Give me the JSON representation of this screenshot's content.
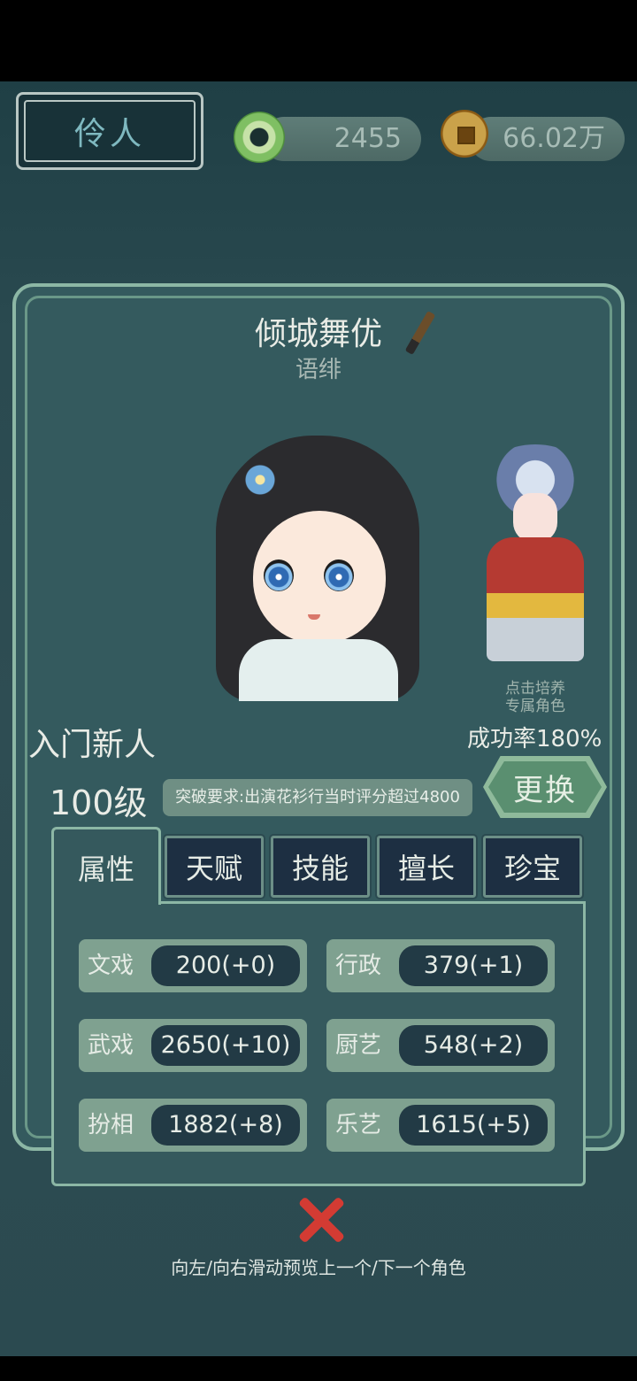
{
  "header": {
    "title": "伶人",
    "jade_amount": "2455",
    "coin_amount": "66.02万"
  },
  "character": {
    "name": "倾城舞优",
    "subtitle": "语绯",
    "rank": "入门新人",
    "level": "100级"
  },
  "special_role": {
    "caption_line1": "点击培养",
    "caption_line2": "专属角色",
    "success_rate": "成功率180%"
  },
  "breakthrough": {
    "requirement": "突破要求:出演花衫行当时评分超过4800"
  },
  "change_button": "更换",
  "tabs": [
    {
      "label": "属性",
      "active": true
    },
    {
      "label": "天赋"
    },
    {
      "label": "技能"
    },
    {
      "label": "擅长"
    },
    {
      "label": "珍宝"
    }
  ],
  "stats": [
    {
      "label": "文戏",
      "value": "200(+0)"
    },
    {
      "label": "行政",
      "value": "379(+1)"
    },
    {
      "label": "武戏",
      "value": "2650(+10)"
    },
    {
      "label": "厨艺",
      "value": "548(+2)"
    },
    {
      "label": "扮相",
      "value": "1882(+8)"
    },
    {
      "label": "乐艺",
      "value": "1615(+5)"
    }
  ],
  "hint": "向左/向右滑动预览上一个/下一个角色",
  "back_button": "返回",
  "colors": {
    "panel": "#345a5e",
    "accent_green": "#8cb7a5",
    "close_red": "#d33b33"
  },
  "icons": [
    "jade-icon",
    "coin-icon",
    "brush-icon",
    "close-icon"
  ]
}
